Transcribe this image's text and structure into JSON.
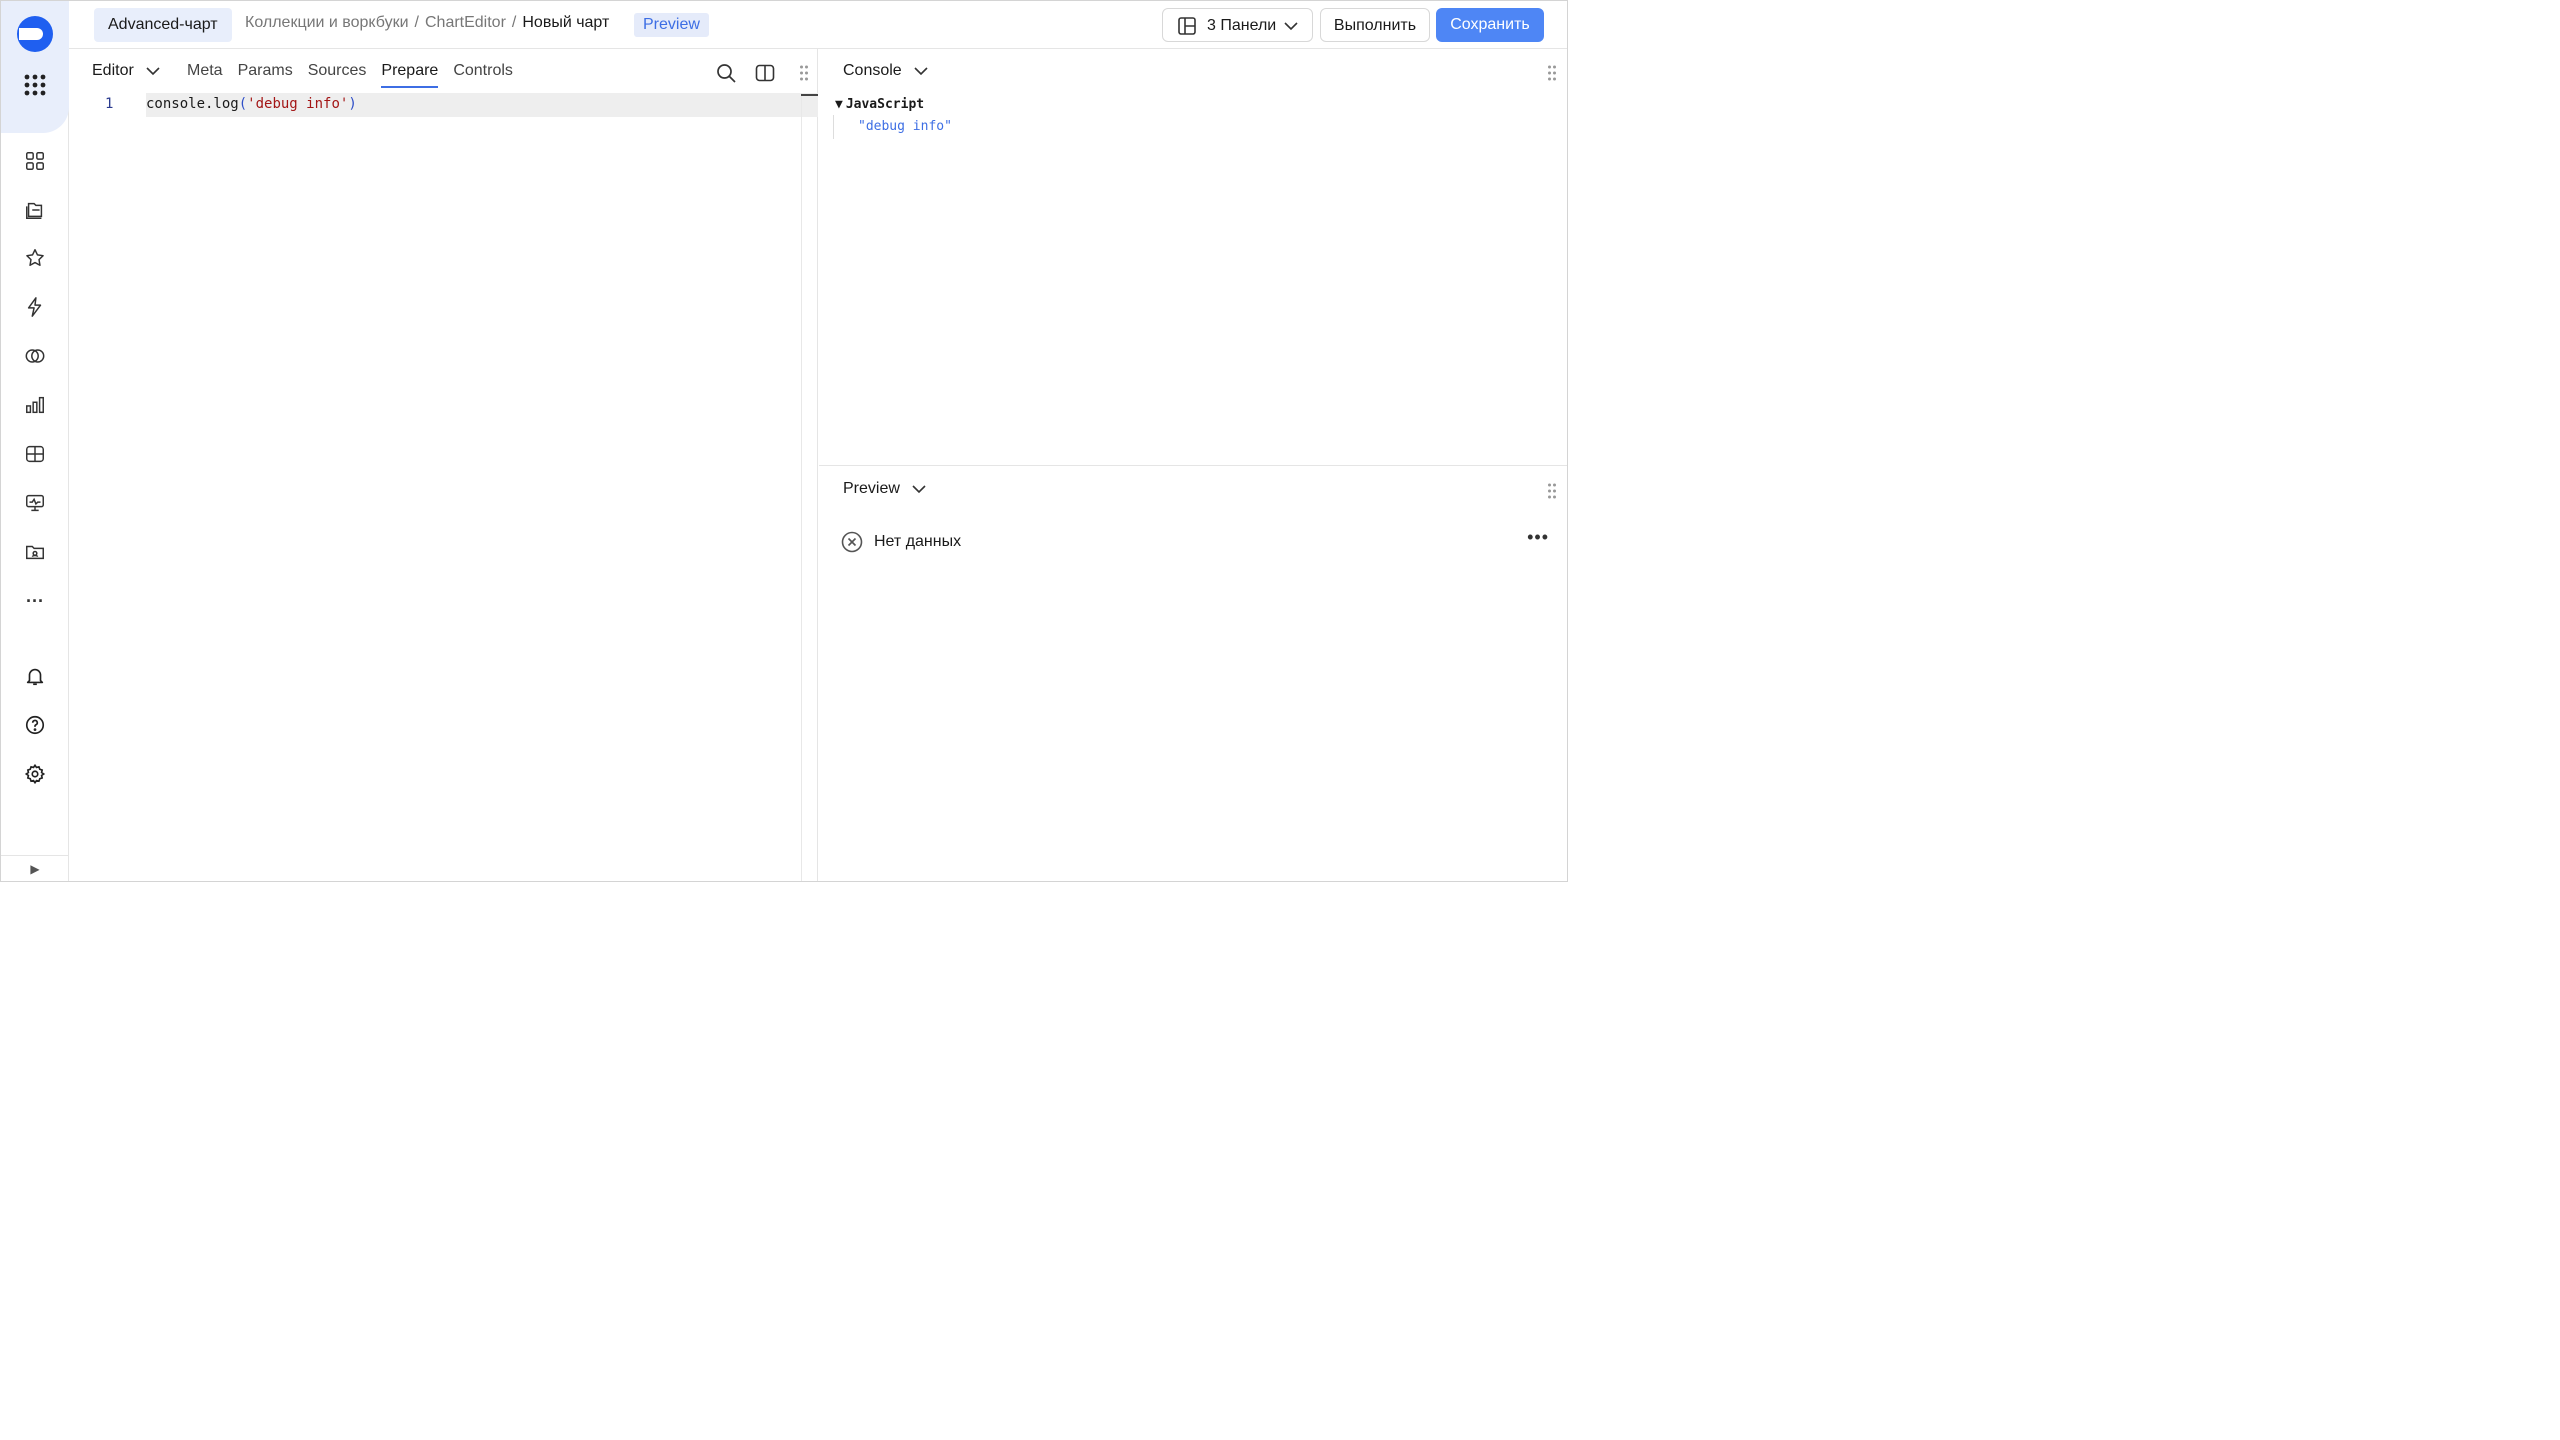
{
  "header": {
    "chart_type": "Advanced-чарт",
    "breadcrumbs": [
      "Коллекции и воркбуки",
      "ChartEditor"
    ],
    "separator": "/",
    "current": "Новый чарт",
    "preview_badge": "Preview",
    "panels_label": "3 Панели",
    "run_label": "Выполнить",
    "save_label": "Сохранить"
  },
  "nav": {
    "items": [
      "collections-icon",
      "folders-icon",
      "favorites-icon",
      "connections-icon",
      "datasets-icon",
      "charts-icon",
      "dashboards-icon",
      "monitoring-icon",
      "files-icon",
      "more-icon"
    ],
    "bottom": [
      "notifications-icon",
      "help-icon",
      "settings-icon"
    ],
    "collapse_glyph": "▶",
    "more_glyph": "···"
  },
  "editor": {
    "title": "Editor",
    "tabs": [
      "Meta",
      "Params",
      "Sources",
      "Prepare",
      "Controls"
    ],
    "active_tab": "Prepare",
    "line_number": "1",
    "code": {
      "fn": "console.log",
      "open": "(",
      "arg": "'debug info'",
      "close": ")"
    }
  },
  "console": {
    "title": "Console",
    "group": "JavaScript",
    "group_toggle": "▼",
    "output": "\"debug info\""
  },
  "preview": {
    "title": "Preview",
    "more": "•••",
    "empty_text": "Нет данных"
  },
  "colors": {
    "accent": "#4e86f5",
    "link": "#3d6ee4",
    "rail_highlight": "#e8eefb"
  }
}
